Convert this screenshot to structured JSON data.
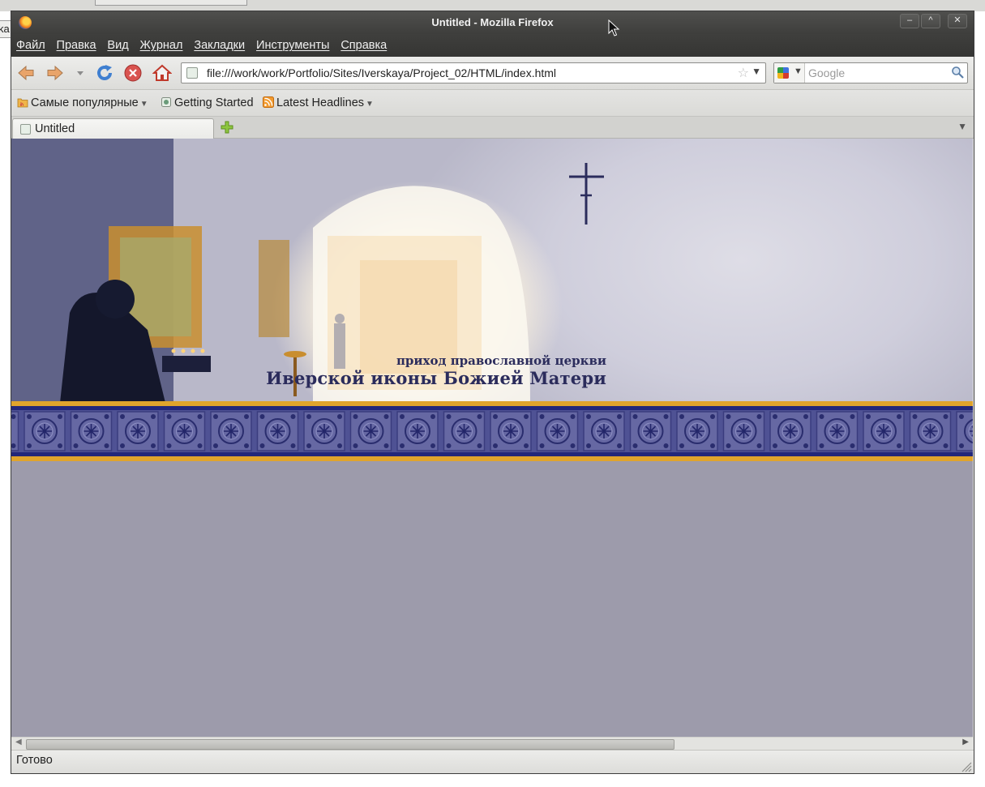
{
  "window": {
    "title": "Untitled - Mozilla Firefox",
    "controls": {
      "minimize": "–",
      "maximize": "^",
      "close": "✕"
    }
  },
  "desktop": {
    "left_fragment": "ka"
  },
  "menubar": {
    "items": [
      {
        "label": "Файл"
      },
      {
        "label": "Правка"
      },
      {
        "label": "Вид"
      },
      {
        "label": "Журнал"
      },
      {
        "label": "Закладки"
      },
      {
        "label": "Инструменты"
      },
      {
        "label": "Справка"
      }
    ]
  },
  "navbar": {
    "url": "file:///work/work/Portfolio/Sites/Iverskaya/Project_02/HTML/index.html",
    "search_placeholder": "Google"
  },
  "bookmarks": {
    "items": [
      {
        "label": "Самые популярные",
        "icon": "folder-rss-icon",
        "has_dropdown": true
      },
      {
        "label": "Getting Started",
        "icon": "page-icon",
        "has_dropdown": false
      },
      {
        "label": "Latest Headlines",
        "icon": "rss-icon",
        "has_dropdown": true
      }
    ]
  },
  "tabs": [
    {
      "label": "Untitled",
      "active": true
    }
  ],
  "page": {
    "header_subtitle": "приход православной церкви",
    "header_title": "Иверской иконы Божией Матери",
    "colors": {
      "background": "#9d9bab",
      "ornament_blue": "#22277a",
      "gold_band": "#e0a42c"
    }
  },
  "statusbar": {
    "text": "Готово"
  }
}
